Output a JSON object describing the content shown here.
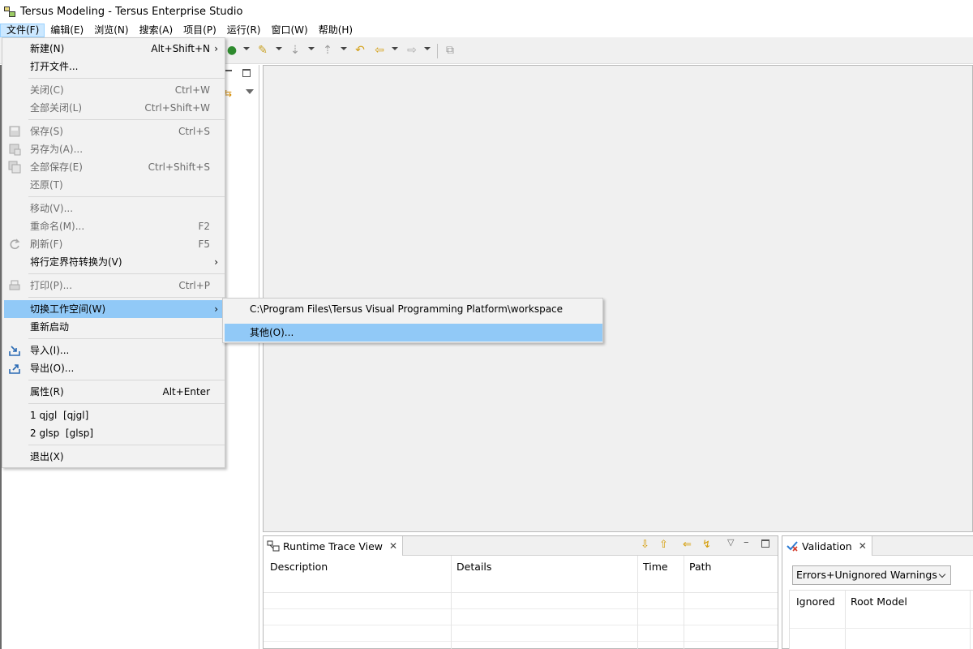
{
  "window": {
    "title": "Tersus Modeling - Tersus Enterprise Studio"
  },
  "menubar": [
    {
      "label": "文件(F)"
    },
    {
      "label": "编辑(E)"
    },
    {
      "label": "浏览(N)"
    },
    {
      "label": "搜索(A)"
    },
    {
      "label": "项目(P)"
    },
    {
      "label": "运行(R)"
    },
    {
      "label": "窗口(W)"
    },
    {
      "label": "帮助(H)"
    }
  ],
  "file_menu": {
    "new": {
      "label": "新建(N)",
      "accel": "Alt+Shift+N"
    },
    "open_file": {
      "label": "打开文件..."
    },
    "close": {
      "label": "关闭(C)",
      "accel": "Ctrl+W"
    },
    "close_all": {
      "label": "全部关闭(L)",
      "accel": "Ctrl+Shift+W"
    },
    "save": {
      "label": "保存(S)",
      "accel": "Ctrl+S"
    },
    "save_as": {
      "label": "另存为(A)..."
    },
    "save_all": {
      "label": "全部保存(E)",
      "accel": "Ctrl+Shift+S"
    },
    "revert": {
      "label": "还原(T)"
    },
    "move": {
      "label": "移动(V)..."
    },
    "rename": {
      "label": "重命名(M)...",
      "accel": "F2"
    },
    "refresh": {
      "label": "刷新(F)",
      "accel": "F5"
    },
    "convert_line_delimiters": {
      "label": "将行定界符转换为(V)"
    },
    "print": {
      "label": "打印(P)...",
      "accel": "Ctrl+P"
    },
    "switch_workspace": {
      "label": "切换工作空间(W)"
    },
    "restart": {
      "label": "重新启动"
    },
    "import": {
      "label": "导入(I)..."
    },
    "export": {
      "label": "导出(O)..."
    },
    "properties": {
      "label": "属性(R)",
      "accel": "Alt+Enter"
    },
    "recent": [
      {
        "label": "1 qjgl  [qjgl]"
      },
      {
        "label": "2 glsp  [glsp]"
      }
    ],
    "exit": {
      "label": "退出(X)"
    }
  },
  "workspace_submenu": {
    "items": [
      {
        "label": "C:\\Program Files\\Tersus Visual Programming Platform\\workspace"
      },
      {
        "label": "其他(O)..."
      }
    ]
  },
  "runtime_trace_view": {
    "title": "Runtime Trace View",
    "columns": [
      "Description",
      "Details",
      "Time",
      "Path"
    ]
  },
  "validation_view": {
    "title": "Validation",
    "filter_value": "Errors+Unignored Warnings",
    "columns": [
      "Ignored",
      "Root Model"
    ]
  }
}
